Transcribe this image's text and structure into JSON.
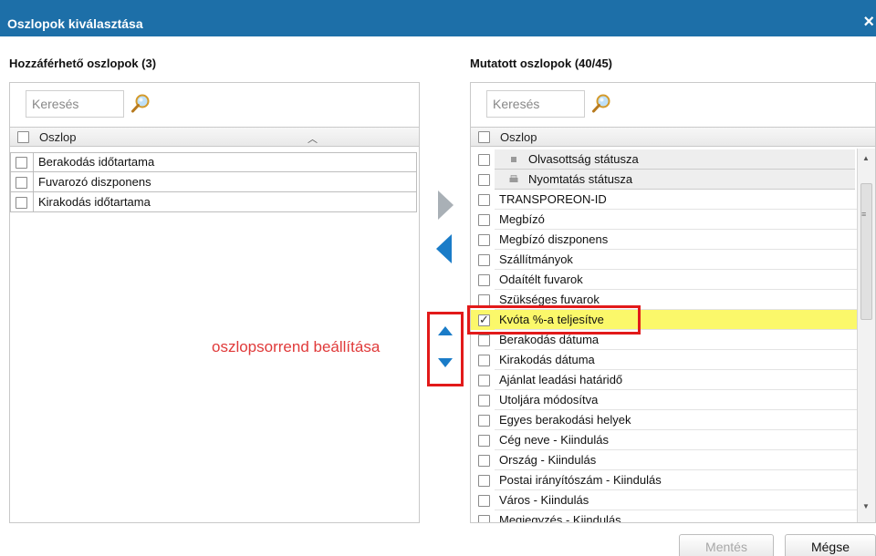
{
  "dialog": {
    "title": "Oszlopok kiválasztása",
    "close_label": "×"
  },
  "available": {
    "title": "Hozzáférhető oszlopok (3)",
    "search_placeholder": "Keresés",
    "column_header": "Oszlop",
    "items": [
      {
        "label": "Berakodás időtartama",
        "checked": false
      },
      {
        "label": "Fuvarozó diszponens",
        "checked": false
      },
      {
        "label": "Kirakodás időtartama",
        "checked": false
      }
    ]
  },
  "shown": {
    "title": "Mutatott oszlopok (40/45)",
    "search_placeholder": "Keresés",
    "column_header": "Oszlop",
    "items": [
      {
        "label": "Olvasottság státusza",
        "checked": false,
        "icon": "square-icon",
        "grey": true
      },
      {
        "label": "Nyomtatás státusza",
        "checked": false,
        "icon": "printer-icon",
        "grey": true
      },
      {
        "label": "TRANSPOREON-ID",
        "checked": false
      },
      {
        "label": "Megbízó",
        "checked": false
      },
      {
        "label": "Megbízó diszponens",
        "checked": false
      },
      {
        "label": "Szállítmányok",
        "checked": false
      },
      {
        "label": "Odaítélt fuvarok",
        "checked": false
      },
      {
        "label": "Szükséges fuvarok",
        "checked": false
      },
      {
        "label": "Kvóta %-a teljesítve",
        "checked": true,
        "highlight": true
      },
      {
        "label": "Berakodás dátuma",
        "checked": false
      },
      {
        "label": "Kirakodás dátuma",
        "checked": false
      },
      {
        "label": "Ajánlat leadási határidő",
        "checked": false
      },
      {
        "label": "Utoljára módosítva",
        "checked": false
      },
      {
        "label": "Egyes berakodási helyek",
        "checked": false
      },
      {
        "label": "Cég neve - Kiindulás",
        "checked": false
      },
      {
        "label": "Ország - Kiindulás",
        "checked": false
      },
      {
        "label": "Postai irányítószám - Kiindulás",
        "checked": false
      },
      {
        "label": "Város - Kiindulás",
        "checked": false
      },
      {
        "label": "Megjegyzés - Kiindulás",
        "checked": false
      }
    ]
  },
  "annotation": "oszlopsorrend beállítása",
  "buttons": {
    "save": "Mentés",
    "cancel": "Mégse"
  },
  "colors": {
    "titlebar": "#1d6fa8",
    "accent_blue": "#1a7cc8",
    "highlight_row": "#fbf86a",
    "annotation_red": "#e21a1a"
  }
}
